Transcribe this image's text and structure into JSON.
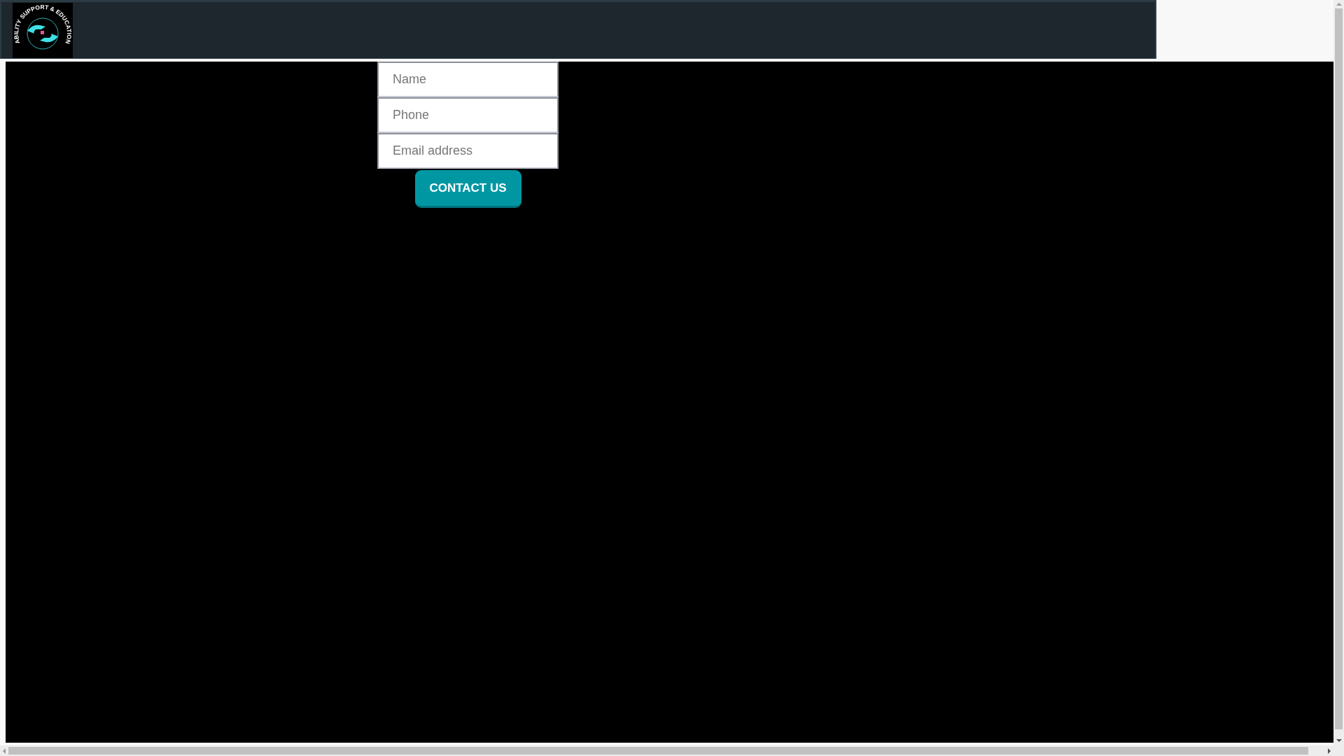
{
  "header": {
    "logo_text": "ABILITY SUPPORT & EDUCATION"
  },
  "form": {
    "fields": [
      {
        "placeholder": "Name"
      },
      {
        "placeholder": "Phone"
      },
      {
        "placeholder": "Email address"
      }
    ],
    "submit": "CONTACT US"
  }
}
